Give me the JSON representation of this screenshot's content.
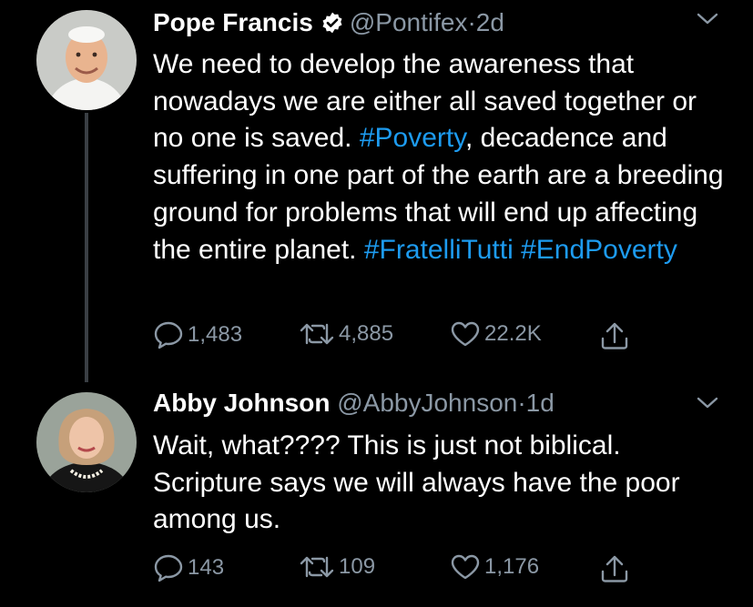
{
  "tweets": [
    {
      "name": "Pope Francis",
      "handle": "@Pontifex",
      "separator": "·",
      "time": "2d",
      "verified": true,
      "text_parts": [
        {
          "text": "We need to develop the awareness that nowadays we are either all saved together or no one is saved. ",
          "hashtag": false
        },
        {
          "text": "#Poverty",
          "hashtag": true
        },
        {
          "text": ", decadence and suffering in one part of the earth are a breeding ground for problems that will end up affecting the entire planet. ",
          "hashtag": false
        },
        {
          "text": "#FratelliTutti",
          "hashtag": true
        },
        {
          "text": " ",
          "hashtag": false
        },
        {
          "text": "#EndPoverty",
          "hashtag": true
        }
      ],
      "replies": "1,483",
      "retweets": "4,885",
      "likes": "22.2K"
    },
    {
      "name": "Abby Johnson",
      "handle": "@AbbyJohnson",
      "separator": "·",
      "time": "1d",
      "verified": false,
      "text_parts": [
        {
          "text": "Wait, what???? This is just not biblical. Scripture says we will always have the poor among us.",
          "hashtag": false
        }
      ],
      "replies": "143",
      "retweets": "109",
      "likes": "1,176"
    }
  ],
  "colors": {
    "background": "#000000",
    "text": "#ffffff",
    "secondary": "#8b98a5",
    "hashtag": "#1d9bf0",
    "thread_line": "#3a3f44"
  },
  "icons": [
    "verified-badge-icon",
    "chevron-down-icon",
    "reply-icon",
    "retweet-icon",
    "like-icon",
    "share-icon"
  ]
}
